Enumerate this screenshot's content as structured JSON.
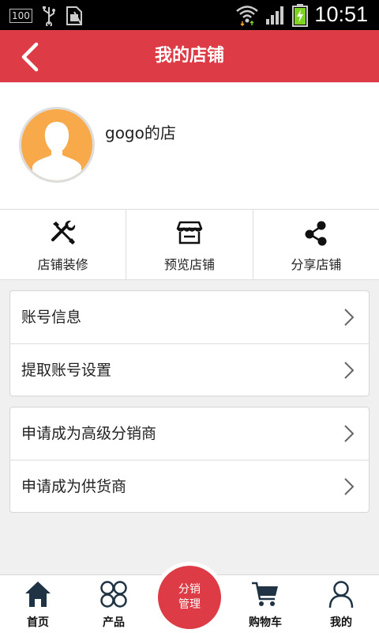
{
  "status_bar": {
    "battery_badge": "100",
    "time": "10:51"
  },
  "header": {
    "title": "我的店铺",
    "back_icon": "chevron-left-icon"
  },
  "profile": {
    "shop_name": "gogo的店",
    "avatar_icon": "user-silhouette-icon"
  },
  "actions": [
    {
      "label": "店铺装修",
      "icon": "tools-icon"
    },
    {
      "label": "预览店铺",
      "icon": "storefront-icon"
    },
    {
      "label": "分享店铺",
      "icon": "share-icon"
    }
  ],
  "menu_groups": [
    {
      "items": [
        {
          "label": "账号信息"
        },
        {
          "label": "提取账号设置"
        }
      ]
    },
    {
      "items": [
        {
          "label": "申请成为高级分销商"
        },
        {
          "label": "申请成为供货商"
        }
      ]
    }
  ],
  "bottom_nav": {
    "items": [
      {
        "label": "首页",
        "icon": "home-icon"
      },
      {
        "label": "产品",
        "icon": "grid-icon"
      },
      {
        "label": "购物车",
        "icon": "cart-icon"
      },
      {
        "label": "我的",
        "icon": "person-icon"
      }
    ],
    "center": {
      "line1": "分销",
      "line2": "管理"
    }
  },
  "colors": {
    "accent": "#dd3b45",
    "avatar_bg": "#f8aa4a",
    "status_bar": "#000000",
    "page_bg": "#f0f0f0"
  }
}
